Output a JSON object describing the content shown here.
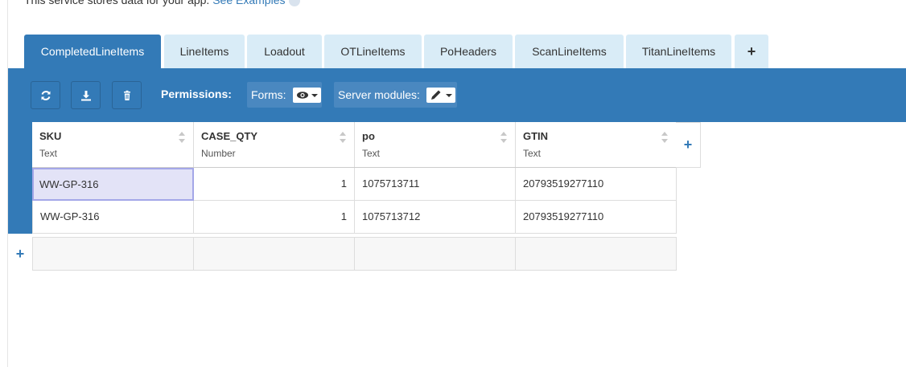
{
  "intro": {
    "text": "This service stores data for your app. ",
    "link": "See Examples"
  },
  "tabs": [
    {
      "label": "CompletedLineItems",
      "active": true
    },
    {
      "label": "LineItems"
    },
    {
      "label": "Loadout"
    },
    {
      "label": "OTLineItems"
    },
    {
      "label": "PoHeaders"
    },
    {
      "label": "ScanLineItems"
    },
    {
      "label": "TitanLineItems"
    },
    {
      "label": "+"
    }
  ],
  "toolbar": {
    "icons": [
      "refresh-icon",
      "download-icon",
      "trash-icon"
    ],
    "permissions_label": "Permissions:",
    "forms_label": "Forms:",
    "server_modules_label": "Server modules:"
  },
  "columns": [
    {
      "name": "SKU",
      "type": "Text"
    },
    {
      "name": "CASE_QTY",
      "type": "Number"
    },
    {
      "name": "po",
      "type": "Text"
    },
    {
      "name": "GTIN",
      "type": "Text"
    }
  ],
  "add_column_label": "+",
  "add_row_label": "+",
  "rows": [
    [
      "WW-GP-316",
      "1",
      "1075713711",
      "20793519277110"
    ],
    [
      "WW-GP-316",
      "1",
      "1075713712",
      "20793519277110"
    ]
  ],
  "colors": {
    "accent": "#337ab7",
    "tab_inactive": "#d9ecf7",
    "selected_cell": "#e3e3f7"
  }
}
